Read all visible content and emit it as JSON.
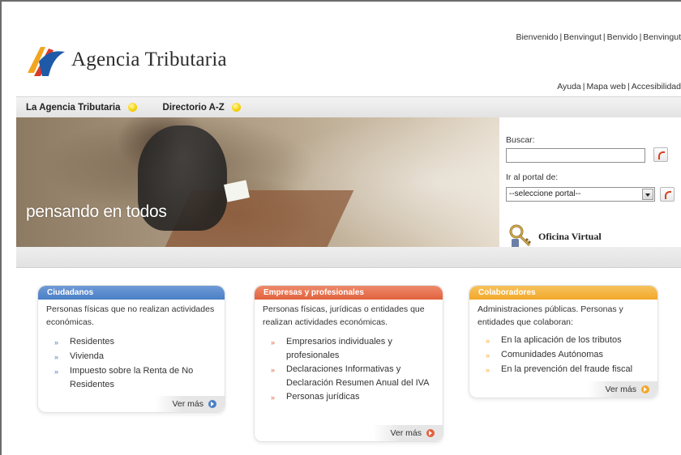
{
  "header": {
    "logo_text": "Agencia Tributaria",
    "languages": [
      "Bienvenido",
      "Benvingut",
      "Benvido",
      "Benvingut"
    ],
    "utility_links": [
      "Ayuda",
      "Mapa web",
      "Accesibilidad"
    ]
  },
  "nav": {
    "items": [
      {
        "label": "La Agencia Tributaria"
      },
      {
        "label": "Directorio A-Z"
      }
    ]
  },
  "hero": {
    "caption": "pensando en todos"
  },
  "sidebar": {
    "search_label": "Buscar:",
    "search_value": "",
    "portal_label": "Ir al portal de:",
    "portal_selected": "--seleccione portal--",
    "oficina_label": "Oficina Virtual"
  },
  "cards": [
    {
      "title": "Ciudadanos",
      "color": "#4a7fc6",
      "description": "Personas físicas que no realizan actividades económicas.",
      "items": [
        "Residentes",
        "Vivienda",
        "Impuesto sobre la Renta de No Residentes"
      ],
      "ver_mas": "Ver más"
    },
    {
      "title": "Empresas y profesionales",
      "color": "#e2623e",
      "description": "Personas físicas, jurídicas o entidades que realizan actividades económicas.",
      "items": [
        "Empresarios individuales y profesionales",
        "Declaraciones Informativas y Declaración Resumen Anual del IVA",
        "Personas jurídicas"
      ],
      "ver_mas": "Ver más"
    },
    {
      "title": "Colaboradores",
      "color": "#f2a82a",
      "description": "Administraciones públicas. Personas y entidades que colaboran:",
      "items": [
        "En la aplicación de los tributos",
        "Comunidades Autónomas",
        "En la prevención del fraude fiscal"
      ],
      "ver_mas": "Ver más"
    }
  ],
  "colors": {
    "ciudadanos": "#4a7fc6",
    "empresas": "#e2623e",
    "colaboradores": "#f2a82a",
    "nav_dot": "#f5d000"
  }
}
